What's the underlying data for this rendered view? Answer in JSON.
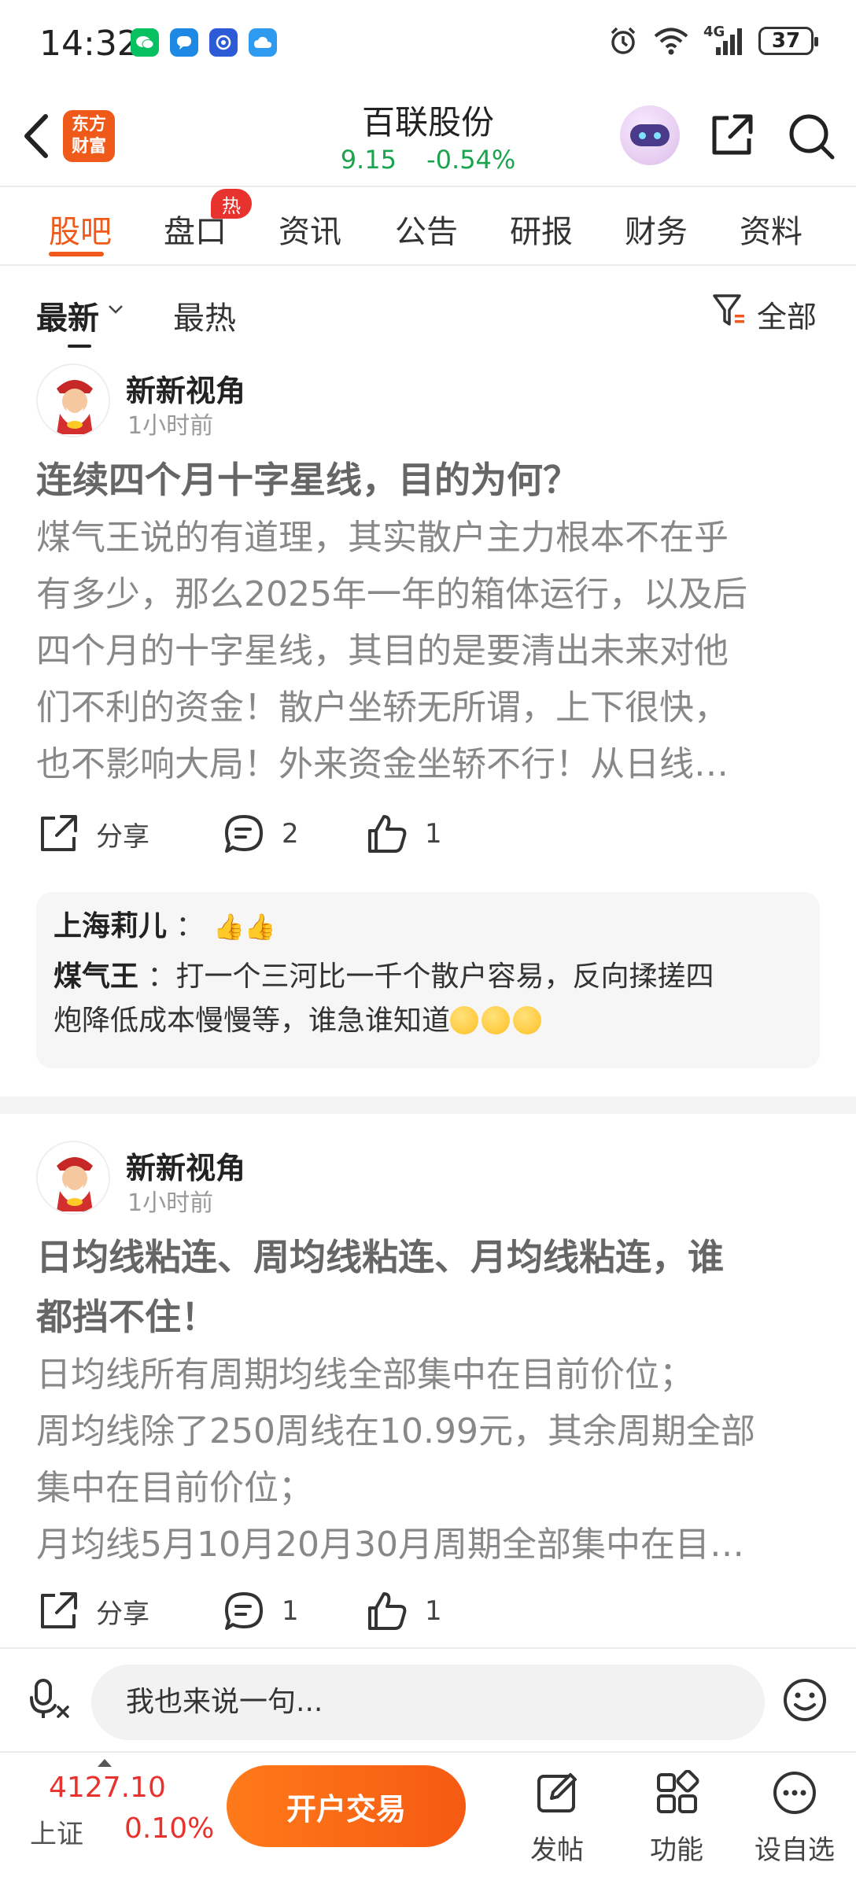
{
  "status_bar": {
    "time": "14:32",
    "network": "4G",
    "battery": "37"
  },
  "header": {
    "logo_line1": "东方",
    "logo_line2": "财富",
    "stock_name": "百联股份",
    "price": "9.15",
    "change_pct": "-0.54%"
  },
  "tabs": [
    {
      "label": "股吧",
      "active": true
    },
    {
      "label": "盘口",
      "badge": "热"
    },
    {
      "label": "资讯"
    },
    {
      "label": "公告"
    },
    {
      "label": "研报"
    },
    {
      "label": "财务"
    },
    {
      "label": "资料"
    }
  ],
  "filter": {
    "sort_latest": "最新",
    "sort_hot": "最热",
    "filter_label": "全部"
  },
  "posts": [
    {
      "author": "新新视角",
      "time": "1小时前",
      "title": "连续四个月十字星线，目的为何？",
      "body_lines": [
        "煤气王说的有道理，其实散户主力根本不在乎",
        "有多少，那么2025年一年的箱体运行，以及后",
        "四个月的十字星线，其目的是要清出未来对他",
        "们不利的资金！散户坐轿无所谓，上下很快，",
        "也不影响大局！外来资金坐轿不行！从日线…"
      ],
      "share_label": "分享",
      "comments": "2",
      "likes": "1",
      "replies": [
        {
          "name": "上海莉儿",
          "sep": "：",
          "text": ""
        },
        {
          "name": "煤气王",
          "sep": "：",
          "text": "打一个三河比一千个散户容易，反向揉搓四",
          "text2": "炮降低成本慢慢等，谁急谁知道"
        }
      ]
    },
    {
      "author": "新新视角",
      "time": "1小时前",
      "title_lines": [
        "日均线粘连、周均线粘连、月均线粘连，谁",
        "都挡不住！"
      ],
      "body_lines": [
        "日均线所有周期均线全部集中在目前价位；",
        "周均线除了250周线在10.99元，其余周期全部",
        "集中在目前价位；",
        "月均线5月10月20月30月周期全部集中在目…"
      ],
      "share_label": "分享",
      "comments": "1",
      "likes": "1"
    }
  ],
  "comment_bar": {
    "placeholder": "我也来说一句..."
  },
  "bottom_nav": {
    "index_value": "4127.10",
    "index_name": "上证",
    "index_pct": "0.10%",
    "open_account": "开户交易",
    "post": "发帖",
    "functions": "功能",
    "watchlist": "设自选"
  },
  "colors": {
    "brand": "#ef5a1a",
    "down_green": "#1aa44e",
    "up_red": "#e8322e"
  }
}
